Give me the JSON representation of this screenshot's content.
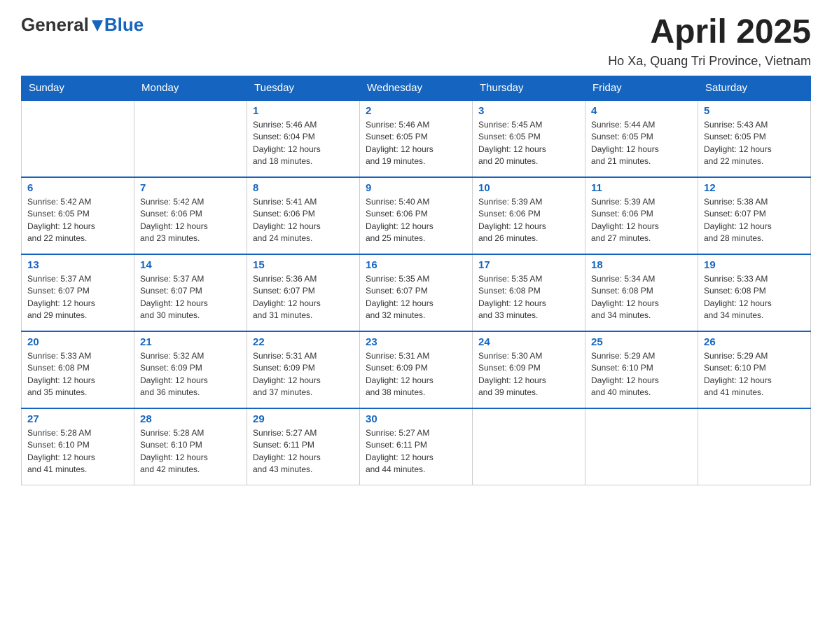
{
  "header": {
    "logo_general": "General",
    "logo_blue": "Blue",
    "title": "April 2025",
    "location": "Ho Xa, Quang Tri Province, Vietnam"
  },
  "days_of_week": [
    "Sunday",
    "Monday",
    "Tuesday",
    "Wednesday",
    "Thursday",
    "Friday",
    "Saturday"
  ],
  "weeks": [
    [
      {
        "day": "",
        "info": ""
      },
      {
        "day": "",
        "info": ""
      },
      {
        "day": "1",
        "info": "Sunrise: 5:46 AM\nSunset: 6:04 PM\nDaylight: 12 hours\nand 18 minutes."
      },
      {
        "day": "2",
        "info": "Sunrise: 5:46 AM\nSunset: 6:05 PM\nDaylight: 12 hours\nand 19 minutes."
      },
      {
        "day": "3",
        "info": "Sunrise: 5:45 AM\nSunset: 6:05 PM\nDaylight: 12 hours\nand 20 minutes."
      },
      {
        "day": "4",
        "info": "Sunrise: 5:44 AM\nSunset: 6:05 PM\nDaylight: 12 hours\nand 21 minutes."
      },
      {
        "day": "5",
        "info": "Sunrise: 5:43 AM\nSunset: 6:05 PM\nDaylight: 12 hours\nand 22 minutes."
      }
    ],
    [
      {
        "day": "6",
        "info": "Sunrise: 5:42 AM\nSunset: 6:05 PM\nDaylight: 12 hours\nand 22 minutes."
      },
      {
        "day": "7",
        "info": "Sunrise: 5:42 AM\nSunset: 6:06 PM\nDaylight: 12 hours\nand 23 minutes."
      },
      {
        "day": "8",
        "info": "Sunrise: 5:41 AM\nSunset: 6:06 PM\nDaylight: 12 hours\nand 24 minutes."
      },
      {
        "day": "9",
        "info": "Sunrise: 5:40 AM\nSunset: 6:06 PM\nDaylight: 12 hours\nand 25 minutes."
      },
      {
        "day": "10",
        "info": "Sunrise: 5:39 AM\nSunset: 6:06 PM\nDaylight: 12 hours\nand 26 minutes."
      },
      {
        "day": "11",
        "info": "Sunrise: 5:39 AM\nSunset: 6:06 PM\nDaylight: 12 hours\nand 27 minutes."
      },
      {
        "day": "12",
        "info": "Sunrise: 5:38 AM\nSunset: 6:07 PM\nDaylight: 12 hours\nand 28 minutes."
      }
    ],
    [
      {
        "day": "13",
        "info": "Sunrise: 5:37 AM\nSunset: 6:07 PM\nDaylight: 12 hours\nand 29 minutes."
      },
      {
        "day": "14",
        "info": "Sunrise: 5:37 AM\nSunset: 6:07 PM\nDaylight: 12 hours\nand 30 minutes."
      },
      {
        "day": "15",
        "info": "Sunrise: 5:36 AM\nSunset: 6:07 PM\nDaylight: 12 hours\nand 31 minutes."
      },
      {
        "day": "16",
        "info": "Sunrise: 5:35 AM\nSunset: 6:07 PM\nDaylight: 12 hours\nand 32 minutes."
      },
      {
        "day": "17",
        "info": "Sunrise: 5:35 AM\nSunset: 6:08 PM\nDaylight: 12 hours\nand 33 minutes."
      },
      {
        "day": "18",
        "info": "Sunrise: 5:34 AM\nSunset: 6:08 PM\nDaylight: 12 hours\nand 34 minutes."
      },
      {
        "day": "19",
        "info": "Sunrise: 5:33 AM\nSunset: 6:08 PM\nDaylight: 12 hours\nand 34 minutes."
      }
    ],
    [
      {
        "day": "20",
        "info": "Sunrise: 5:33 AM\nSunset: 6:08 PM\nDaylight: 12 hours\nand 35 minutes."
      },
      {
        "day": "21",
        "info": "Sunrise: 5:32 AM\nSunset: 6:09 PM\nDaylight: 12 hours\nand 36 minutes."
      },
      {
        "day": "22",
        "info": "Sunrise: 5:31 AM\nSunset: 6:09 PM\nDaylight: 12 hours\nand 37 minutes."
      },
      {
        "day": "23",
        "info": "Sunrise: 5:31 AM\nSunset: 6:09 PM\nDaylight: 12 hours\nand 38 minutes."
      },
      {
        "day": "24",
        "info": "Sunrise: 5:30 AM\nSunset: 6:09 PM\nDaylight: 12 hours\nand 39 minutes."
      },
      {
        "day": "25",
        "info": "Sunrise: 5:29 AM\nSunset: 6:10 PM\nDaylight: 12 hours\nand 40 minutes."
      },
      {
        "day": "26",
        "info": "Sunrise: 5:29 AM\nSunset: 6:10 PM\nDaylight: 12 hours\nand 41 minutes."
      }
    ],
    [
      {
        "day": "27",
        "info": "Sunrise: 5:28 AM\nSunset: 6:10 PM\nDaylight: 12 hours\nand 41 minutes."
      },
      {
        "day": "28",
        "info": "Sunrise: 5:28 AM\nSunset: 6:10 PM\nDaylight: 12 hours\nand 42 minutes."
      },
      {
        "day": "29",
        "info": "Sunrise: 5:27 AM\nSunset: 6:11 PM\nDaylight: 12 hours\nand 43 minutes."
      },
      {
        "day": "30",
        "info": "Sunrise: 5:27 AM\nSunset: 6:11 PM\nDaylight: 12 hours\nand 44 minutes."
      },
      {
        "day": "",
        "info": ""
      },
      {
        "day": "",
        "info": ""
      },
      {
        "day": "",
        "info": ""
      }
    ]
  ]
}
